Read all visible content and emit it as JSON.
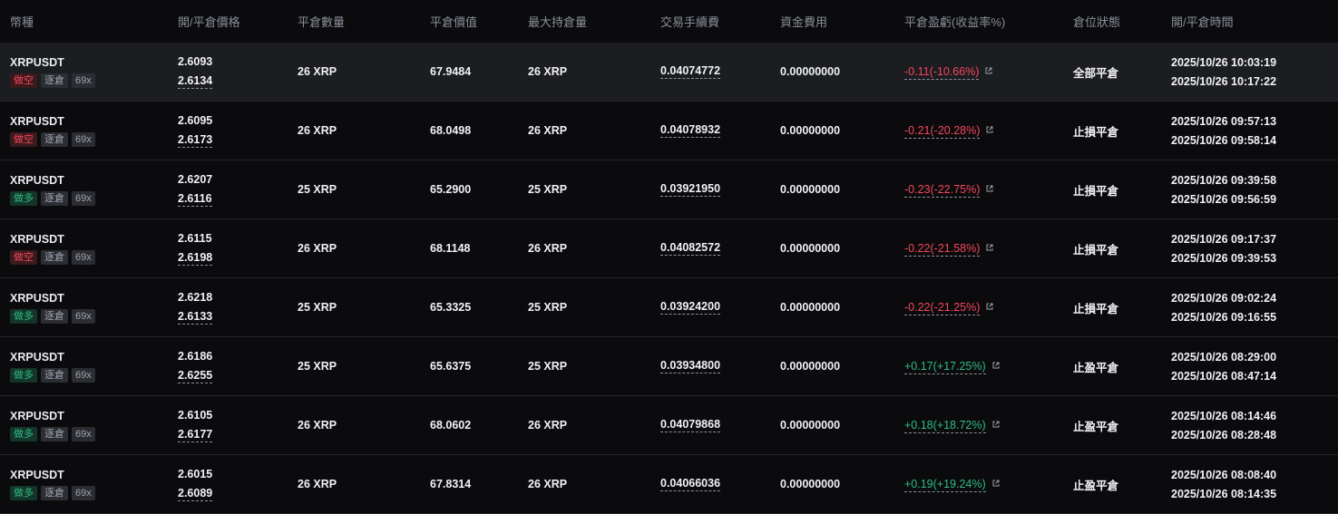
{
  "headers": {
    "symbol": "幣種",
    "price": "開/平倉價格",
    "close_qty": "平倉數量",
    "close_value": "平倉價值",
    "max_hold": "最大持倉量",
    "fee": "交易手續費",
    "funding": "資金費用",
    "pnl": "平倉盈虧(收益率%)",
    "status": "倉位狀態",
    "time": "開/平倉時間"
  },
  "colors": {
    "negative": "#f6465d",
    "positive": "#2ebd85",
    "background": "#0b0b0d",
    "highlight": "#1c1d21"
  },
  "rows": [
    {
      "symbol": "XRPUSDT",
      "side": "做空",
      "side_type": "short",
      "margin": "逐倉",
      "leverage": "69x",
      "open_price": "2.6093",
      "close_price": "2.6134",
      "close_qty": "26 XRP",
      "close_value": "67.9484",
      "max_hold": "26 XRP",
      "fee": "0.04074772",
      "funding": "0.00000000",
      "pnl": "-0.11(-10.66%)",
      "pnl_type": "neg",
      "status": "全部平倉",
      "open_time": "2025/10/26 10:03:19",
      "close_time": "2025/10/26 10:17:22"
    },
    {
      "symbol": "XRPUSDT",
      "side": "做空",
      "side_type": "short",
      "margin": "逐倉",
      "leverage": "69x",
      "open_price": "2.6095",
      "close_price": "2.6173",
      "close_qty": "26 XRP",
      "close_value": "68.0498",
      "max_hold": "26 XRP",
      "fee": "0.04078932",
      "funding": "0.00000000",
      "pnl": "-0.21(-20.28%)",
      "pnl_type": "neg",
      "status": "止損平倉",
      "open_time": "2025/10/26 09:57:13",
      "close_time": "2025/10/26 09:58:14"
    },
    {
      "symbol": "XRPUSDT",
      "side": "做多",
      "side_type": "long",
      "margin": "逐倉",
      "leverage": "69x",
      "open_price": "2.6207",
      "close_price": "2.6116",
      "close_qty": "25 XRP",
      "close_value": "65.2900",
      "max_hold": "25 XRP",
      "fee": "0.03921950",
      "funding": "0.00000000",
      "pnl": "-0.23(-22.75%)",
      "pnl_type": "neg",
      "status": "止損平倉",
      "open_time": "2025/10/26 09:39:58",
      "close_time": "2025/10/26 09:56:59"
    },
    {
      "symbol": "XRPUSDT",
      "side": "做空",
      "side_type": "short",
      "margin": "逐倉",
      "leverage": "69x",
      "open_price": "2.6115",
      "close_price": "2.6198",
      "close_qty": "26 XRP",
      "close_value": "68.1148",
      "max_hold": "26 XRP",
      "fee": "0.04082572",
      "funding": "0.00000000",
      "pnl": "-0.22(-21.58%)",
      "pnl_type": "neg",
      "status": "止損平倉",
      "open_time": "2025/10/26 09:17:37",
      "close_time": "2025/10/26 09:39:53"
    },
    {
      "symbol": "XRPUSDT",
      "side": "做多",
      "side_type": "long",
      "margin": "逐倉",
      "leverage": "69x",
      "open_price": "2.6218",
      "close_price": "2.6133",
      "close_qty": "25 XRP",
      "close_value": "65.3325",
      "max_hold": "25 XRP",
      "fee": "0.03924200",
      "funding": "0.00000000",
      "pnl": "-0.22(-21.25%)",
      "pnl_type": "neg",
      "status": "止損平倉",
      "open_time": "2025/10/26 09:02:24",
      "close_time": "2025/10/26 09:16:55"
    },
    {
      "symbol": "XRPUSDT",
      "side": "做多",
      "side_type": "long",
      "margin": "逐倉",
      "leverage": "69x",
      "open_price": "2.6186",
      "close_price": "2.6255",
      "close_qty": "25 XRP",
      "close_value": "65.6375",
      "max_hold": "25 XRP",
      "fee": "0.03934800",
      "funding": "0.00000000",
      "pnl": "+0.17(+17.25%)",
      "pnl_type": "pos",
      "status": "止盈平倉",
      "open_time": "2025/10/26 08:29:00",
      "close_time": "2025/10/26 08:47:14"
    },
    {
      "symbol": "XRPUSDT",
      "side": "做多",
      "side_type": "long",
      "margin": "逐倉",
      "leverage": "69x",
      "open_price": "2.6105",
      "close_price": "2.6177",
      "close_qty": "26 XRP",
      "close_value": "68.0602",
      "max_hold": "26 XRP",
      "fee": "0.04079868",
      "funding": "0.00000000",
      "pnl": "+0.18(+18.72%)",
      "pnl_type": "pos",
      "status": "止盈平倉",
      "open_time": "2025/10/26 08:14:46",
      "close_time": "2025/10/26 08:28:48"
    },
    {
      "symbol": "XRPUSDT",
      "side": "做多",
      "side_type": "long",
      "margin": "逐倉",
      "leverage": "69x",
      "open_price": "2.6015",
      "close_price": "2.6089",
      "close_qty": "26 XRP",
      "close_value": "67.8314",
      "max_hold": "26 XRP",
      "fee": "0.04066036",
      "funding": "0.00000000",
      "pnl": "+0.19(+19.24%)",
      "pnl_type": "pos",
      "status": "止盈平倉",
      "open_time": "2025/10/26 08:08:40",
      "close_time": "2025/10/26 08:14:35"
    }
  ]
}
